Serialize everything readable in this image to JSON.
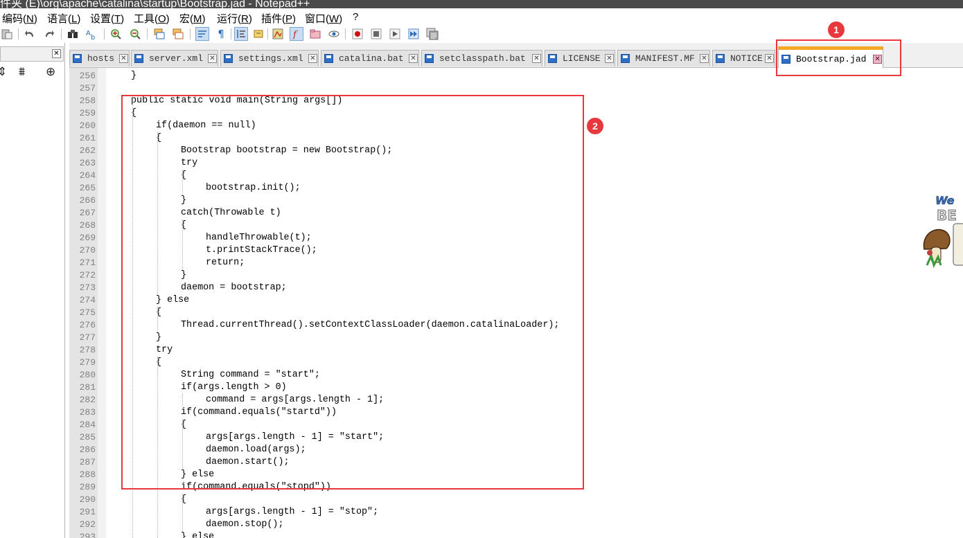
{
  "window": {
    "title_fragment": "件夹 (E)\\org\\apache\\catalina\\startup\\Bootstrap.jad - Notepad++"
  },
  "menu": [
    {
      "label": "编码(",
      "key": "N",
      "tail": ")"
    },
    {
      "label": "语言(",
      "key": "L",
      "tail": ")"
    },
    {
      "label": "设置(",
      "key": "T",
      "tail": ")"
    },
    {
      "label": "工具(",
      "key": "O",
      "tail": ")"
    },
    {
      "label": "宏(",
      "key": "M",
      "tail": ")"
    },
    {
      "label": "运行(",
      "key": "R",
      "tail": ")"
    },
    {
      "label": "插件(",
      "key": "P",
      "tail": ")"
    },
    {
      "label": "窗口(",
      "key": "W",
      "tail": ")"
    },
    {
      "label": "?",
      "key": "",
      "tail": ""
    }
  ],
  "toolbar_icons": [
    "paste-icon",
    "undo-icon",
    "redo-icon",
    "find-icon",
    "replace-icon",
    "zoom-in-icon",
    "zoom-out-icon",
    "sync-vertical-icon",
    "sync-horizontal-icon",
    "word-wrap-icon",
    "show-all-chars-icon",
    "indent-guide-icon",
    "user-language-icon",
    "doc-map-icon",
    "function-list-icon",
    "folder-as-workspace-icon",
    "monitoring-icon",
    "record-macro-icon",
    "stop-record-icon",
    "play-macro-icon",
    "run-macro-multiple-icon",
    "save-macro-icon"
  ],
  "tabs": [
    {
      "label": "hosts",
      "active": false
    },
    {
      "label": "server.xml",
      "active": false
    },
    {
      "label": "settings.xml",
      "active": false
    },
    {
      "label": "catalina.bat",
      "active": false
    },
    {
      "label": "setclasspath.bat",
      "active": false
    },
    {
      "label": "LICENSE",
      "active": false
    },
    {
      "label": "MANIFEST.MF",
      "active": false
    },
    {
      "label": "NOTICE",
      "active": false
    },
    {
      "label": "Bootstrap.jad",
      "active": true
    }
  ],
  "badges": {
    "one": "1",
    "two": "2"
  },
  "colors": {
    "highlight": "#e8383d",
    "active_tab_accent": "#f5a623"
  },
  "code_lines": [
    {
      "n": "256",
      "indent": 1,
      "text": "}"
    },
    {
      "n": "257",
      "indent": 0,
      "text": ""
    },
    {
      "n": "258",
      "indent": 1,
      "text": "public static void main(String args[])"
    },
    {
      "n": "259",
      "indent": 1,
      "text": "{"
    },
    {
      "n": "260",
      "indent": 2,
      "text": "if(daemon == null)"
    },
    {
      "n": "261",
      "indent": 2,
      "text": "{"
    },
    {
      "n": "262",
      "indent": 3,
      "text": "Bootstrap bootstrap = new Bootstrap();"
    },
    {
      "n": "263",
      "indent": 3,
      "text": "try"
    },
    {
      "n": "264",
      "indent": 3,
      "text": "{"
    },
    {
      "n": "265",
      "indent": 4,
      "text": "bootstrap.init();"
    },
    {
      "n": "266",
      "indent": 3,
      "text": "}"
    },
    {
      "n": "267",
      "indent": 3,
      "text": "catch(Throwable t)"
    },
    {
      "n": "268",
      "indent": 3,
      "text": "{"
    },
    {
      "n": "269",
      "indent": 4,
      "text": "handleThrowable(t);"
    },
    {
      "n": "270",
      "indent": 4,
      "text": "t.printStackTrace();"
    },
    {
      "n": "271",
      "indent": 4,
      "text": "return;"
    },
    {
      "n": "272",
      "indent": 3,
      "text": "}"
    },
    {
      "n": "273",
      "indent": 3,
      "text": "daemon = bootstrap;"
    },
    {
      "n": "274",
      "indent": 2,
      "text": "} else"
    },
    {
      "n": "275",
      "indent": 2,
      "text": "{"
    },
    {
      "n": "276",
      "indent": 3,
      "text": "Thread.currentThread().setContextClassLoader(daemon.catalinaLoader);"
    },
    {
      "n": "277",
      "indent": 2,
      "text": "}"
    },
    {
      "n": "278",
      "indent": 2,
      "text": "try"
    },
    {
      "n": "279",
      "indent": 2,
      "text": "{"
    },
    {
      "n": "280",
      "indent": 3,
      "text": "String command = \"start\";"
    },
    {
      "n": "281",
      "indent": 3,
      "text": "if(args.length > 0)"
    },
    {
      "n": "282",
      "indent": 4,
      "text": "command = args[args.length - 1];"
    },
    {
      "n": "283",
      "indent": 3,
      "text": "if(command.equals(\"startd\"))"
    },
    {
      "n": "284",
      "indent": 3,
      "text": "{"
    },
    {
      "n": "285",
      "indent": 4,
      "text": "args[args.length - 1] = \"start\";"
    },
    {
      "n": "286",
      "indent": 4,
      "text": "daemon.load(args);"
    },
    {
      "n": "287",
      "indent": 4,
      "text": "daemon.start();"
    },
    {
      "n": "288",
      "indent": 3,
      "text": "} else"
    },
    {
      "n": "289",
      "indent": 3,
      "text": "if(command.equals(\"stopd\"))"
    },
    {
      "n": "290",
      "indent": 3,
      "text": "{"
    },
    {
      "n": "291",
      "indent": 4,
      "text": "args[args.length - 1] = \"stop\";"
    },
    {
      "n": "292",
      "indent": 4,
      "text": "daemon.stop();"
    },
    {
      "n": "293",
      "indent": 3,
      "text": "} else"
    }
  ]
}
